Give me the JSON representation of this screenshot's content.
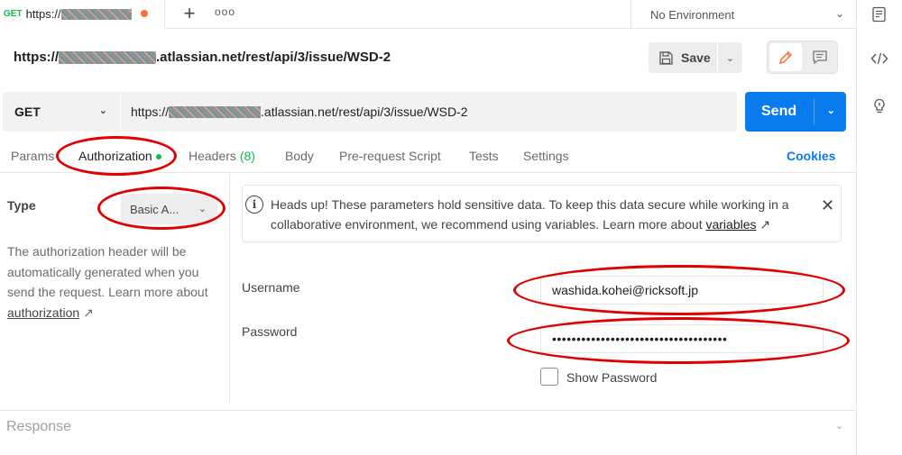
{
  "tab": {
    "method": "GET",
    "url_prefix": "https://"
  },
  "environment": {
    "selected": "No Environment"
  },
  "request": {
    "title_url_prefix": "https://",
    "title_url_suffix": ".atlassian.net/rest/api/3/issue/WSD-2",
    "method": "GET",
    "url_prefix": "https://",
    "url_suffix": ".atlassian.net/rest/api/3/issue/WSD-2"
  },
  "toolbar": {
    "save_label": "Save"
  },
  "send": {
    "label": "Send"
  },
  "request_tabs": {
    "params": "Params",
    "authorization": "Authorization",
    "headers": "Headers",
    "headers_count": "(8)",
    "body": "Body",
    "pre_request": "Pre-request Script",
    "tests": "Tests",
    "settings": "Settings",
    "cookies": "Cookies"
  },
  "auth": {
    "type_label": "Type",
    "type_value": "Basic A...",
    "description": "The authorization header will be automatically generated when you send the request. Learn more about ",
    "description_link": "authorization",
    "info_text": "Heads up! These parameters hold sensitive data. To keep this data secure while working in a collaborative environment, we recommend using variables. Learn more about ",
    "info_link": "variables",
    "username_label": "Username",
    "username_value": "washida.kohei@ricksoft.jp",
    "password_label": "Password",
    "password_value": "••••••••••••••••••••••••••••••••••••",
    "show_password_label": "Show Password"
  },
  "response": {
    "label": "Response"
  },
  "colors": {
    "accent": "#097bed",
    "method_get": "#0cbb52",
    "unsaved_dot": "#ff6c37",
    "annotation": "#e00000"
  }
}
